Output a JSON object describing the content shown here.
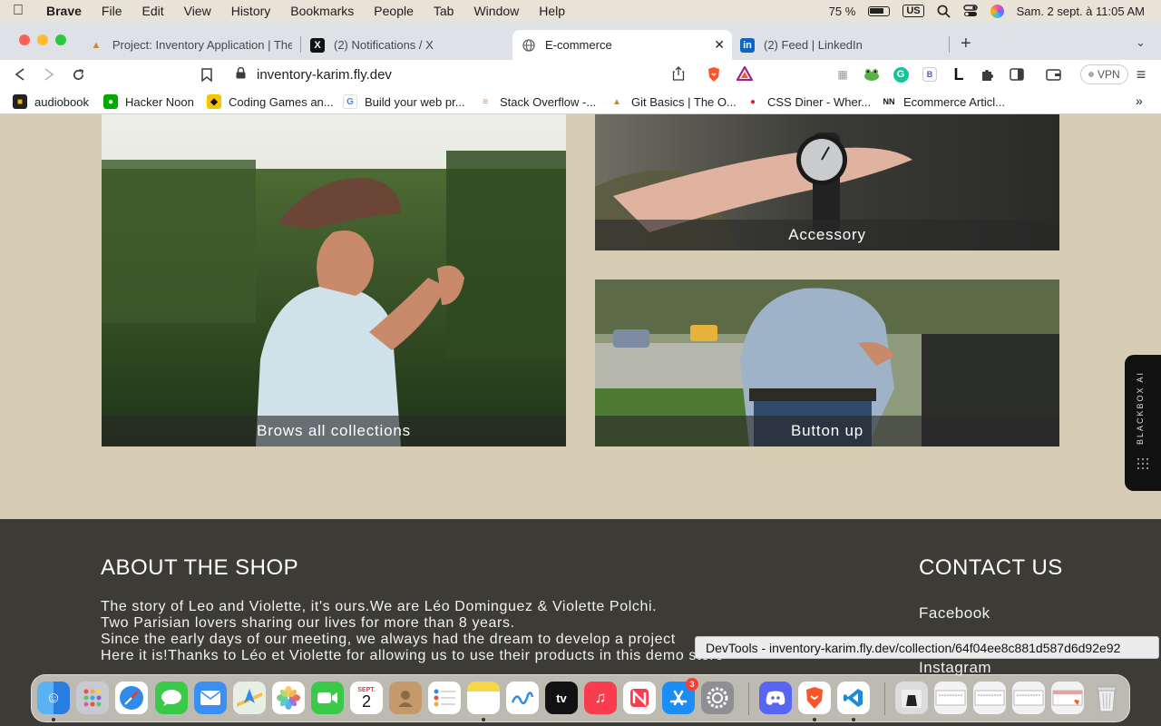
{
  "menubar": {
    "app": "Brave",
    "menus": [
      "File",
      "Edit",
      "View",
      "History",
      "Bookmarks",
      "People",
      "Tab",
      "Window",
      "Help"
    ],
    "battery": "75 %",
    "input_source": "US",
    "datetime": "Sam. 2 sept. à 11:05 AM"
  },
  "tabs": [
    {
      "title": "Project: Inventory Application | The",
      "icon": "odin-icon"
    },
    {
      "title": "(2) Notifications / X",
      "icon": "x-icon"
    },
    {
      "title": "E-commerce",
      "icon": "globe-icon"
    },
    {
      "title": "(2) Feed | LinkedIn",
      "icon": "linkedin-icon"
    }
  ],
  "toolbar": {
    "url": "inventory-karim.fly.dev",
    "vpn_label": "VPN"
  },
  "bookmarks": [
    {
      "label": "audiobook"
    },
    {
      "label": "Hacker Noon"
    },
    {
      "label": "Coding Games an..."
    },
    {
      "label": "Build your web pr..."
    },
    {
      "label": "Stack Overflow -..."
    },
    {
      "label": "Git Basics | The O..."
    },
    {
      "label": "CSS Diner - Wher..."
    },
    {
      "label": "Ecommerce Articl..."
    }
  ],
  "page": {
    "collections": [
      {
        "caption": "Brows all collections"
      },
      {
        "caption": "Accessory"
      },
      {
        "caption": "Button up"
      }
    ],
    "footer": {
      "about_heading": "ABOUT THE SHOP",
      "about_lines": [
        "The story of Leo and Violette, it's ours.We are Léo Dominguez & Violette Polchi.",
        "Two Parisian lovers sharing our lives for more than 8 years.",
        "Since the early days of our meeting, we always had the dream to develop a project",
        "Here it is!Thanks to Léo et Violette for allowing us to use their products in this demo store"
      ],
      "contact_heading": "CONTACT US",
      "contact_links": [
        "Facebook",
        "Instagram"
      ]
    },
    "blackbox_label": "BLACKBOX AI"
  },
  "tooltip": "DevTools - inventory-karim.fly.dev/collection/64f04ee8c881d587d6d92e92",
  "dock": {
    "calendar_month": "SEPT.",
    "calendar_day": "2",
    "appstore_badge": "3",
    "tv_label": "tv"
  }
}
